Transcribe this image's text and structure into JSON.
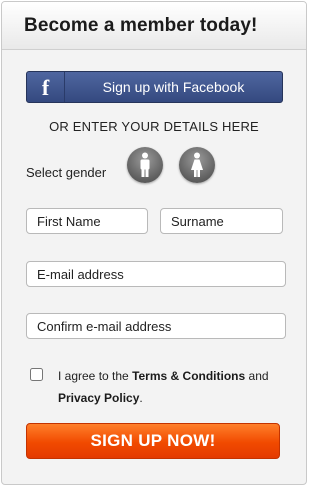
{
  "header": {
    "title": "Become a member today!"
  },
  "facebook": {
    "logo_glyph": "f",
    "label": "Sign up with Facebook"
  },
  "divider_text": "OR ENTER YOUR DETAILS HERE",
  "gender": {
    "label": "Select gender",
    "options": [
      "male-icon",
      "female-icon"
    ]
  },
  "fields": {
    "first_name_placeholder": "First Name",
    "surname_placeholder": "Surname",
    "email_placeholder": "E-mail address",
    "confirm_email_placeholder": "Confirm e-mail address"
  },
  "agreement": {
    "checked": false,
    "prefix": "I agree to the ",
    "terms_link": "Terms & Conditions",
    "middle": " and ",
    "privacy_link": "Privacy Policy",
    "suffix": "."
  },
  "submit_label": "SIGN UP NOW!",
  "colors": {
    "facebook_blue": "#3b5998",
    "signup_orange": "#f14a00",
    "panel_bg": "#f3f3f3"
  }
}
